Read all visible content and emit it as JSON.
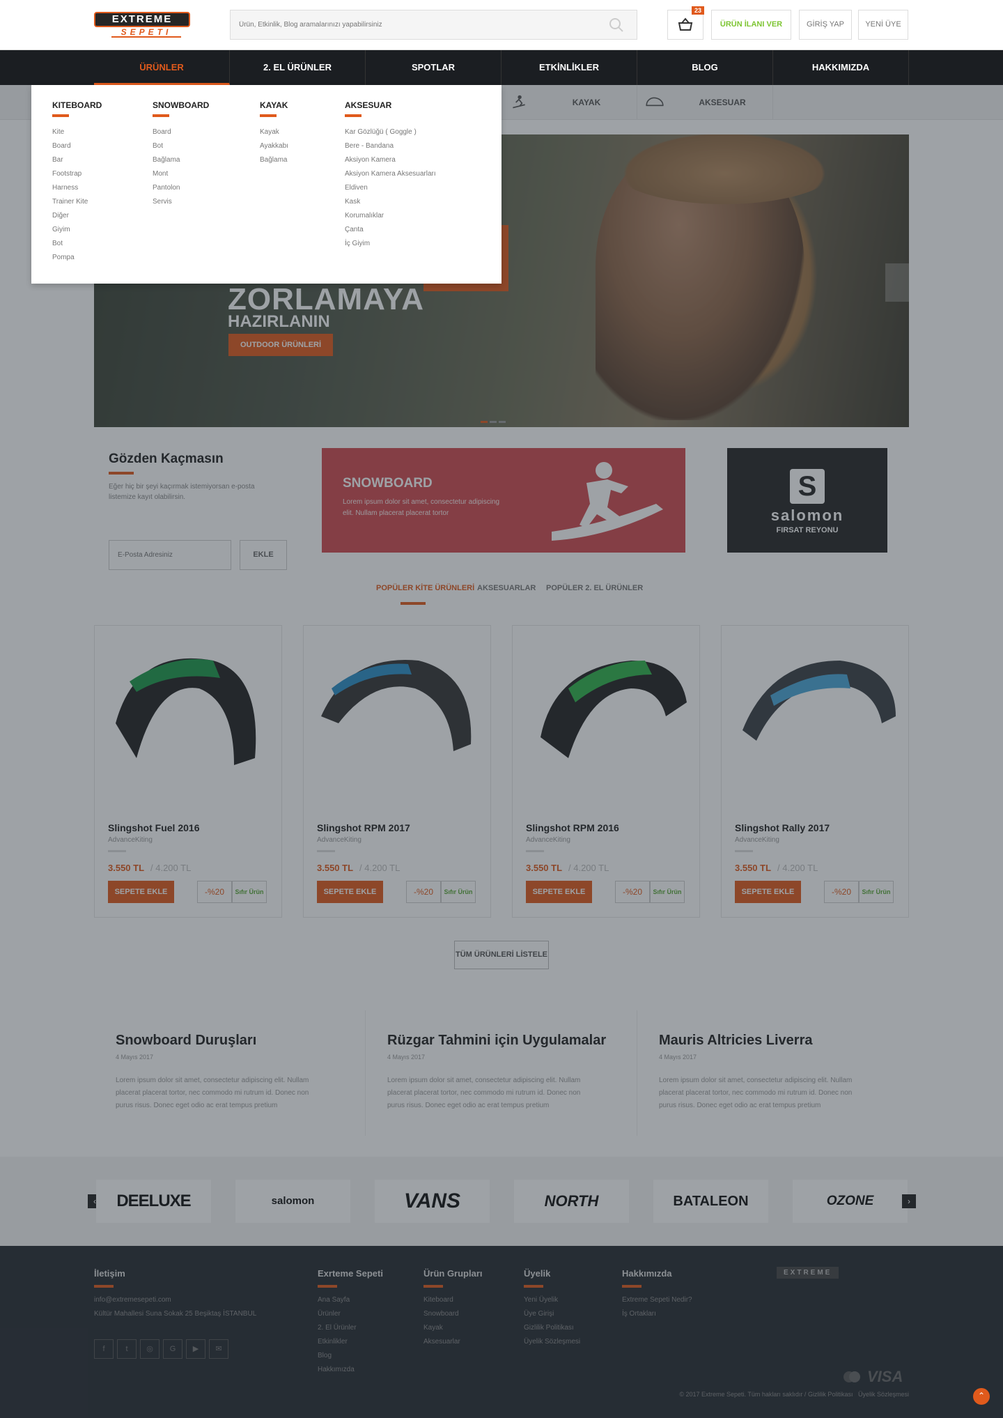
{
  "header": {
    "logo_top": "EXTREME",
    "logo_bottom": "SEPETI",
    "search_placeholder": "Ürün, Etkinlik, Blog aramalarınızı yapabilirsiniz",
    "cart_count": "23",
    "post_ad": "ÜRÜN İLANI VER",
    "login": "GİRİŞ YAP",
    "register": "YENİ ÜYE"
  },
  "nav": [
    "ÜRÜNLER",
    "2. EL ÜRÜNLER",
    "SPOTLAR",
    "ETKİNLİKLER",
    "BLOG",
    "HAKKIMIZDA"
  ],
  "subnav": [
    "KAYAK",
    "AKSESUAR"
  ],
  "mega": [
    {
      "title": "KITEBOARD",
      "items": [
        "Kite",
        "Board",
        "Bar",
        "Footstrap",
        "Harness",
        "Trainer Kite",
        "Diğer",
        "Giyim",
        "Bot",
        "Pompa"
      ]
    },
    {
      "title": "SNOWBOARD",
      "items": [
        "Board",
        "Bot",
        "Bağlama",
        "Mont",
        "Pantolon",
        "Servis"
      ]
    },
    {
      "title": "KAYAK",
      "items": [
        "Kayak",
        "Ayakkabı",
        "Bağlama"
      ]
    },
    {
      "title": "AKSESUAR",
      "items": [
        "Kar Gözlüğü ( Goggle )",
        "Bere - Bandana",
        "Aksiyon Kamera",
        "Aksiyon Kamera Aksesuarları",
        "Eldiven",
        "Kask",
        "Korumalıklar",
        "Çanta",
        "İç Giyim"
      ]
    }
  ],
  "hero": {
    "line1": "ZORLAMAYA",
    "line2": "HAZIRLANIN",
    "button": "OUTDOOR ÜRÜNLERİ"
  },
  "newsletter": {
    "title": "Gözden Kaçmasın",
    "text": "Eğer hiç bir şeyi kaçırmak istemiyorsan e-posta listemize kayıt olabilirsin.",
    "placeholder": "E-Posta Adresiniz",
    "button": "EKLE"
  },
  "snowboard_promo": {
    "title": "SNOWBOARD",
    "text": "Lorem ipsum dolor sit amet, consectetur adipiscing elit. Nullam placerat placerat tortor"
  },
  "salomon_promo": {
    "logo": "salomon",
    "label": "FIRSAT REYONU"
  },
  "tabs": [
    "POPÜLER KİTE ÜRÜNLERİ",
    "AKSESUARLAR",
    "POPÜLER 2. EL ÜRÜNLER"
  ],
  "products": [
    {
      "name": "Slingshot Fuel 2016",
      "brand": "AdvanceKiting",
      "price": "3.550 TL",
      "old_price": "/ 4.200 TL",
      "discount": "-%20",
      "badge": "Sıfır Ürün",
      "button": "SEPETE EKLE",
      "accent": "#1c9a4a"
    },
    {
      "name": "Slingshot RPM 2017",
      "brand": "AdvanceKiting",
      "price": "3.550 TL",
      "old_price": "/ 4.200 TL",
      "discount": "-%20",
      "badge": "Sıfır Ürün",
      "button": "SEPETE EKLE",
      "accent": "#2a8fc7"
    },
    {
      "name": "Slingshot RPM 2016",
      "brand": "AdvanceKiting",
      "price": "3.550 TL",
      "old_price": "/ 4.200 TL",
      "discount": "-%20",
      "badge": "Sıfır Ürün",
      "button": "SEPETE EKLE",
      "accent": "#2fb34a"
    },
    {
      "name": "Slingshot Rally 2017",
      "brand": "AdvanceKiting",
      "price": "3.550 TL",
      "old_price": "/ 4.200 TL",
      "discount": "-%20",
      "badge": "Sıfır Ürün",
      "button": "SEPETE EKLE",
      "accent": "#4aa6d8"
    }
  ],
  "list_all": "TÜM ÜRÜNLERİ LİSTELE",
  "posts": [
    {
      "title": "Snowboard Duruşları",
      "date": "4 Mayıs 2017",
      "text": "Lorem ipsum dolor sit amet, consectetur adipiscing elit. Nullam placerat placerat tortor, nec commodo mi rutrum id. Donec non purus risus. Donec eget odio ac erat tempus pretium"
    },
    {
      "title": "Rüzgar Tahmini için Uygulamalar",
      "date": "4 Mayıs 2017",
      "text": "Lorem ipsum dolor sit amet, consectetur adipiscing elit. Nullam placerat placerat tortor, nec commodo mi rutrum id. Donec non purus risus. Donec eget odio ac erat tempus pretium"
    },
    {
      "title": "Mauris Altricies Liverra",
      "date": "4 Mayıs 2017",
      "text": "Lorem ipsum dolor sit amet, consectetur adipiscing elit. Nullam placerat placerat tortor, nec commodo mi rutrum id. Donec non purus risus. Donec eget odio ac erat tempus pretium"
    }
  ],
  "brands": [
    "DEELUXE",
    "salomon",
    "VANS",
    "NORTH",
    "BATALEON",
    "OZONE"
  ],
  "footer": {
    "contact_title": "İletişim",
    "email": "info@extremesepeti.com",
    "address": "Kültür Mahallesi Suna Sokak 25 Beşiktaş İSTANBUL",
    "cols": [
      {
        "title": "Exrteme Sepeti",
        "items": [
          "Ana Sayfa",
          "Ürünler",
          "2. El Ürünler",
          "Etkinlikler",
          "Blog",
          "Hakkımızda"
        ]
      },
      {
        "title": "Ürün Grupları",
        "items": [
          "Kiteboard",
          "Snowboard",
          "Kayak",
          "Aksesuarlar"
        ]
      },
      {
        "title": "Üyelik",
        "items": [
          "Yeni Üyelik",
          "Üye Girişi",
          "Gizlilik Politikası",
          "Üyelik Sözleşmesi"
        ]
      },
      {
        "title": "Hakkımızda",
        "items": [
          "Extreme Sepeti Nedir?",
          "İş Ortakları"
        ]
      }
    ],
    "copyright": "© 2017 Extreme Sepeti. Tüm hakları saklıdır",
    "privacy": "Gizlilik Politikası",
    "terms": "Üyelik Sözleşmesi",
    "partner": "EXTREME",
    "visa": "VISA"
  }
}
